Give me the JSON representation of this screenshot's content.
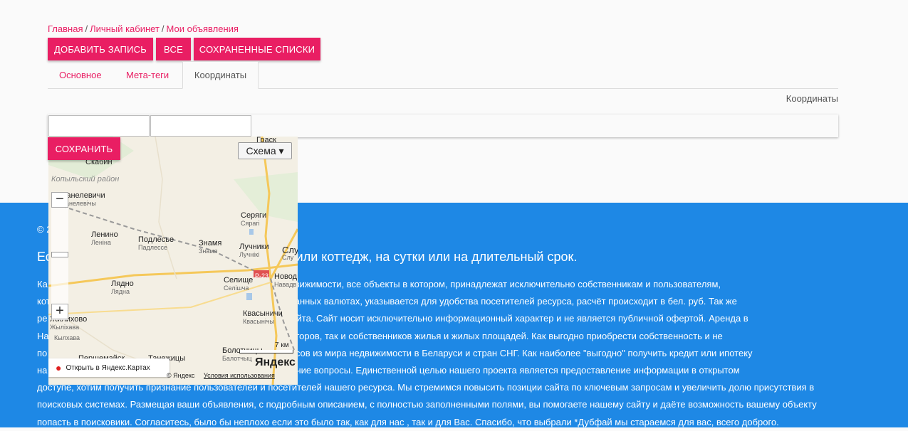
{
  "breadcrumb": {
    "items": [
      "Главная",
      "Личный кабинет",
      "Мои объявления"
    ],
    "separator": "/"
  },
  "toolbar": {
    "add_label": "ДОБАВИТЬ ЗАПИСЬ",
    "all_label": "ВСЕ",
    "saved_label": "СОХРАНЕННЫЕ СПИСКИ"
  },
  "tabs": [
    {
      "label": "Основное",
      "active": false
    },
    {
      "label": "Мета-теги",
      "active": false
    },
    {
      "label": "Координаты",
      "active": true
    }
  ],
  "coords_header": "Координаты",
  "inputs": {
    "lat_value": "",
    "lon_value": ""
  },
  "save_label": "СОХРАНИТЬ",
  "map": {
    "type_selector": "Схема ▾",
    "region": "Копыльский район",
    "places": [
      {
        "name": "Граск",
        "sub": ""
      },
      {
        "name": "Скабин",
        "sub": ""
      },
      {
        "name": "Ванелевичи",
        "sub": "Ванелевічы"
      },
      {
        "name": "Серяги",
        "sub": "Сярагі"
      },
      {
        "name": "Ленино",
        "sub": "Леніна"
      },
      {
        "name": "Подлесье",
        "sub": "Падлессе"
      },
      {
        "name": "Знамя",
        "sub": "Знамя"
      },
      {
        "name": "Лучники",
        "sub": "Лучнікі"
      },
      {
        "name": "Слу",
        "sub": "Слу"
      },
      {
        "name": "Селище",
        "sub": "Селішча"
      },
      {
        "name": "Лядно",
        "sub": "Лядна"
      },
      {
        "name": "Новод",
        "sub": "Навадв"
      },
      {
        "name": "Квасыничи",
        "sub": "Квасынічы"
      },
      {
        "name": "Жилихово",
        "sub": "Жыліхава"
      },
      {
        "name": "Болотчицы",
        "sub": "Балотчыц"
      },
      {
        "name": "Першемайск",
        "sub": ""
      },
      {
        "name": "Танежицы",
        "sub": ""
      },
      {
        "name": "Кылхава",
        "sub": ""
      }
    ],
    "road_label": "Р-23",
    "scale_label": "7 км",
    "logo": "Яндекс",
    "open_link": "Открыть в Яндекс.Картах",
    "copyright": "© Яндекс",
    "terms": "Условия использования",
    "colors": {
      "road": "#f5c85a",
      "water": "#a8c8e8"
    }
  },
  "footer": {
    "copy": "© 2",
    "heading": "Ес                                                  ртиру, дом или коттедж, на сутки или на длительный срок.",
    "text_lines": [
      "Ка                                                                 вляем каталог недвижимости, все объекты в котором, принадлежат исключительно собственникам и пользователям,",
      "кот                                                                ние цены в иностранных валютах, указывается для удобства посетителей ресурса, расчёт происходит в бел. руб. Так же",
      "ре                                                                  администрации сайта. Сайт носит исключительно информационный характер и не является публичной офертой. Аренда в",
      "На                                                                 ующий как арендаторов, так и собственников жилья и жилых площадей. Как выгодно приобрести собственность и не",
      "по                                                                 тересующих вопросов из мира недвижимости в Беларуси и стран СНГ. Как наиболее \"выгодно\" получить кредит или ипотеку",
      "на                                                                 ь заграницей и прочие вопросы. Единственной целью нашего проекта является предоставление информации в открытом",
      "доступе, хотим получить признание пользователей и посетителей нашего ресурса. Мы стремимся повысить позиции сайта по ключевым запросам и увеличить долю присутствия в",
      "поисковых системах. Размещая ваши объявления, с подробным описанием, с полностью заполненными полями, вы помогаете нашему сайту и даёте возможность вашему объекту",
      "попасть в поисковики. Согласитесь, было бы неплохо если это было так, как для нас , так и для Вас. Спасибо, что выбрали *Дубфай мы стараемся для вас, всего доброго."
    ]
  }
}
